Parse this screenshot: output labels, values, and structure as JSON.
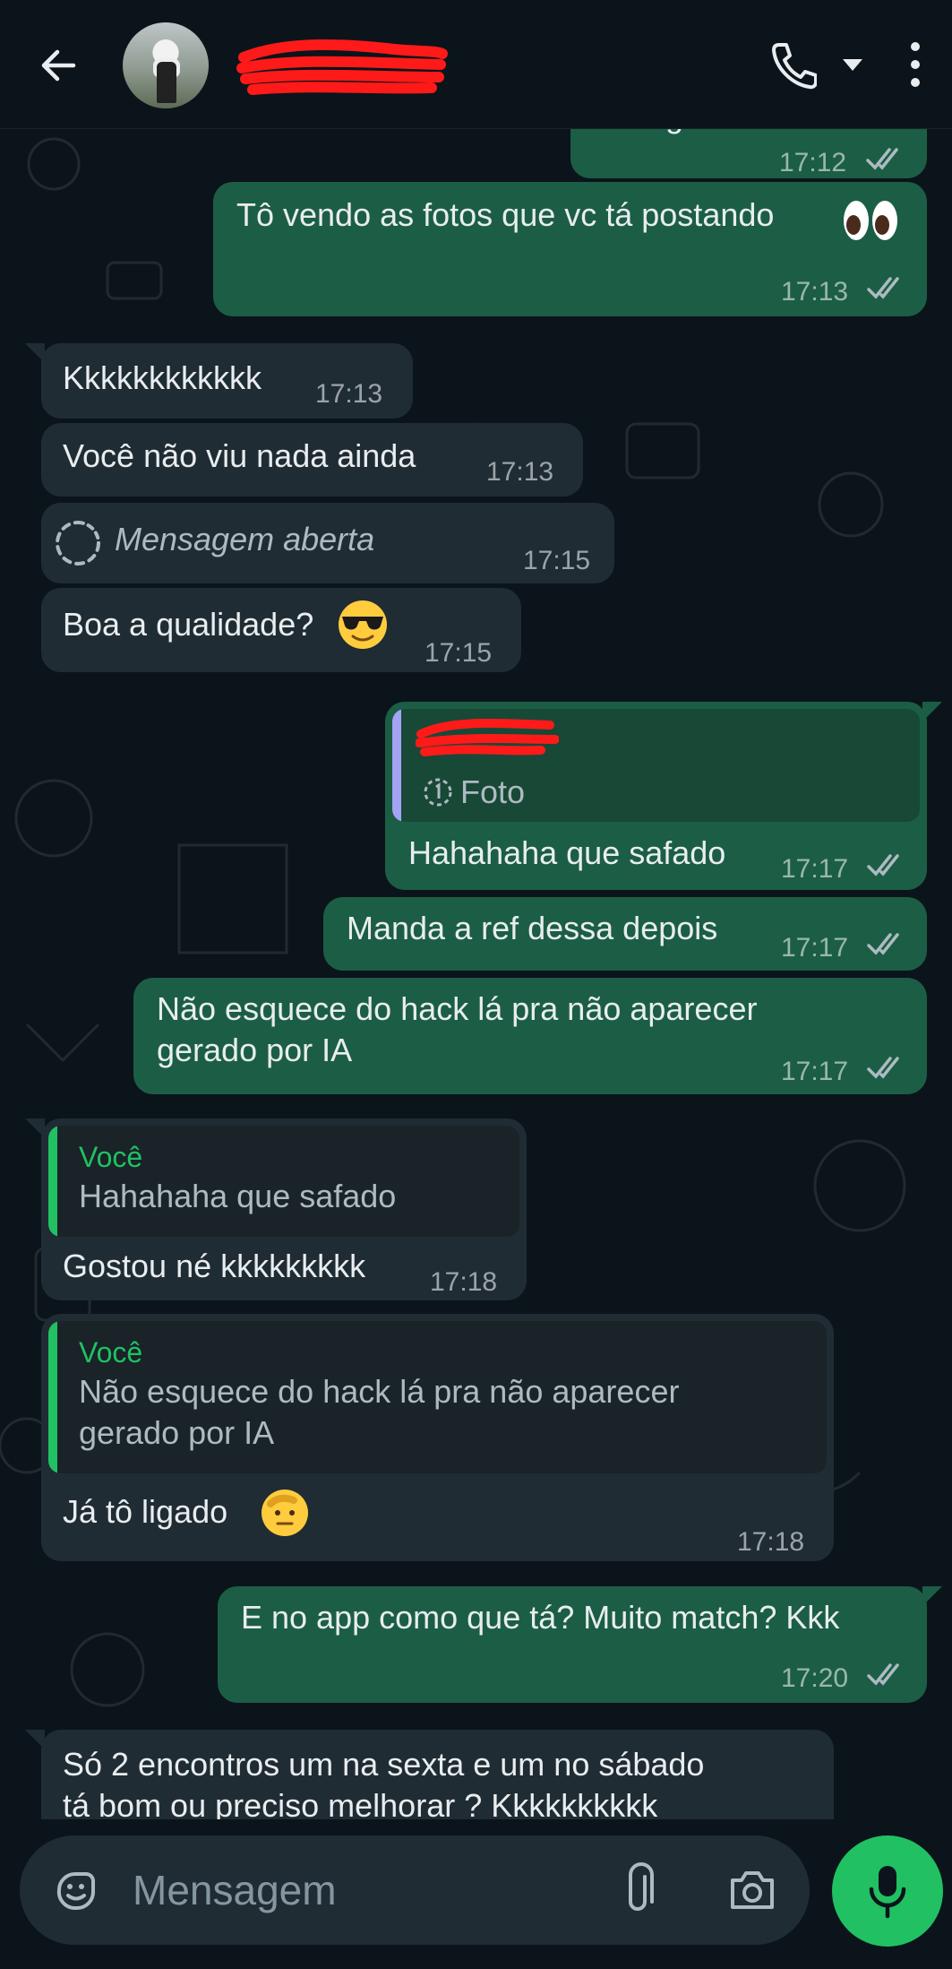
{
  "header": {
    "back_icon": "arrow-left-icon",
    "call_icon": "phone-icon",
    "call_dropdown_icon": "caret-down-icon",
    "menu_icon": "vertical-dots-icon"
  },
  "messages": [
    {
      "dir": "out",
      "text": "Fala gatão",
      "time": "17:12"
    },
    {
      "dir": "out",
      "text": "Tô vendo as fotos que vc tá postando",
      "time": "17:13",
      "emoji": "eyes"
    },
    {
      "dir": "in",
      "text": "Kkkkkkkkkkkk",
      "time": "17:13"
    },
    {
      "dir": "in",
      "text": "Você não viu nada ainda",
      "time": "17:13"
    },
    {
      "dir": "in",
      "text": "Mensagem aberta",
      "time": "17:15",
      "icon": "view-once-opened-icon"
    },
    {
      "dir": "in",
      "text": "Boa a qualidade?",
      "time": "17:15",
      "emoji": "sunglasses"
    },
    {
      "dir": "out",
      "quote_text": "Foto",
      "quote_icon": "view-once-icon",
      "text": "Hahahaha que safado",
      "time": "17:17"
    },
    {
      "dir": "out",
      "text": "Manda a ref dessa depois",
      "time": "17:17"
    },
    {
      "dir": "out",
      "text_line1": "Não esquece do hack lá pra não aparecer",
      "text_line2": "gerado por IA",
      "time": "17:17"
    },
    {
      "dir": "in",
      "quote_author": "Você",
      "quote_text": "Hahahaha que safado",
      "text": "Gostou né kkkkkkkkk",
      "time": "17:18"
    },
    {
      "dir": "in",
      "quote_author": "Você",
      "quote_line1": "Não esquece do hack lá pra não aparecer",
      "quote_line2": "gerado por IA",
      "text": "Já tô ligado",
      "time": "17:18",
      "emoji": "saluting-face"
    },
    {
      "dir": "out",
      "text": "E no app como que tá? Muito match? Kkk",
      "time": "17:20"
    },
    {
      "dir": "in",
      "text_line1": "Só 2 encontros um na sexta e um no sábado",
      "text_line2": "tá bom ou preciso melhorar ? Kkkkkkkkkk"
    }
  ],
  "composer": {
    "placeholder": "Mensagem",
    "sticker_icon": "sticker-icon",
    "attach_icon": "paperclip-icon",
    "camera_icon": "camera-icon",
    "mic_icon": "microphone-icon"
  },
  "colors": {
    "background": "#0b141a",
    "incoming_bubble": "#202c33",
    "outgoing_bubble": "#1b5e45",
    "accent_green": "#21c063",
    "quote_author": "#53bdeb"
  }
}
